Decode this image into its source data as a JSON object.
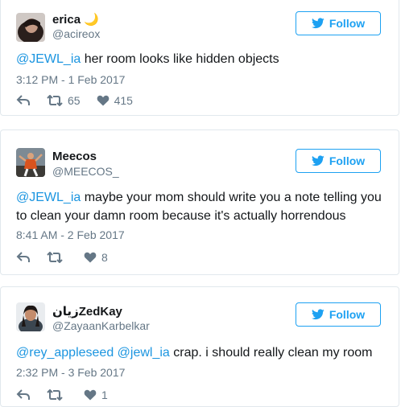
{
  "colors": {
    "accent": "#1da1f2",
    "link": "#1b95e0",
    "muted": "#657786",
    "border": "#e1e8ed"
  },
  "tweets": [
    {
      "name": "erica 🌙",
      "handle": "@acireox",
      "follow_label": "Follow",
      "mention": "@JEWL_ia",
      "text": " her room looks like hidden objects",
      "time": "3:12 PM - 1 Feb 2017",
      "retweets": "65",
      "likes": "415"
    },
    {
      "name": "Meecos",
      "handle": "@MEECOS_",
      "follow_label": "Follow",
      "mention": "@JEWL_ia",
      "text_line1": " maybe your mom should write you a note telling you",
      "text_line2": "to clean your damn room because it's actually horrendous",
      "time": "8:41 AM - 2 Feb 2017",
      "retweets": "",
      "likes": "8"
    },
    {
      "name": "زيانZedKay",
      "handle": "@ZayaanKarbelkar",
      "follow_label": "Follow",
      "mention1": "@rey_appleseed",
      "mention2": "@jewl_ia",
      "text": " crap. i should really clean my room",
      "time": "2:32 PM - 3 Feb 2017",
      "retweets": "",
      "likes": "1"
    }
  ]
}
